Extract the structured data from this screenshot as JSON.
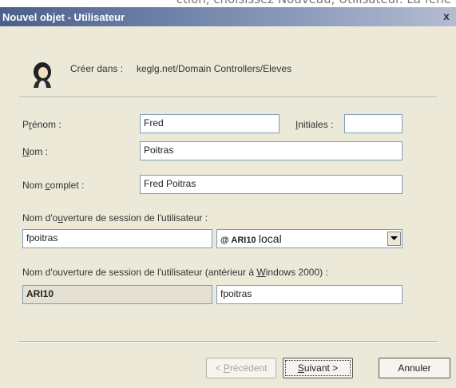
{
  "background_text": "ction, choisissez Nouveau, Utilisateur. La fenê",
  "window": {
    "title": "Nouvel objet - Utilisateur",
    "close_glyph": "x"
  },
  "header": {
    "create_in_label": "Créer dans :",
    "create_in_path": "keglg.net/Domain Controllers/Eleves"
  },
  "form": {
    "first_name_label": "Prénom :",
    "first_name_value": "Fred",
    "initials_label": "Initiales :",
    "initials_value": "",
    "last_name_label": "Nom :",
    "last_name_value": "Poitras",
    "full_name_label": "Nom complet :",
    "full_name_value": "Fred Poitras",
    "logon_label": "Nom d'ouverture de session de l'utilisateur :",
    "logon_value": "fpoitras",
    "domain_prefix": "@ ARI10",
    "domain_suffix": "local",
    "legacy_label": "Nom d'ouverture de session de l'utilisateur (antérieur à Windows 2000) :",
    "legacy_domain": "ARI10",
    "legacy_value": "fpoitras"
  },
  "buttons": {
    "previous": "< Précédent",
    "next": "Suivant >",
    "cancel": "Annuler"
  }
}
